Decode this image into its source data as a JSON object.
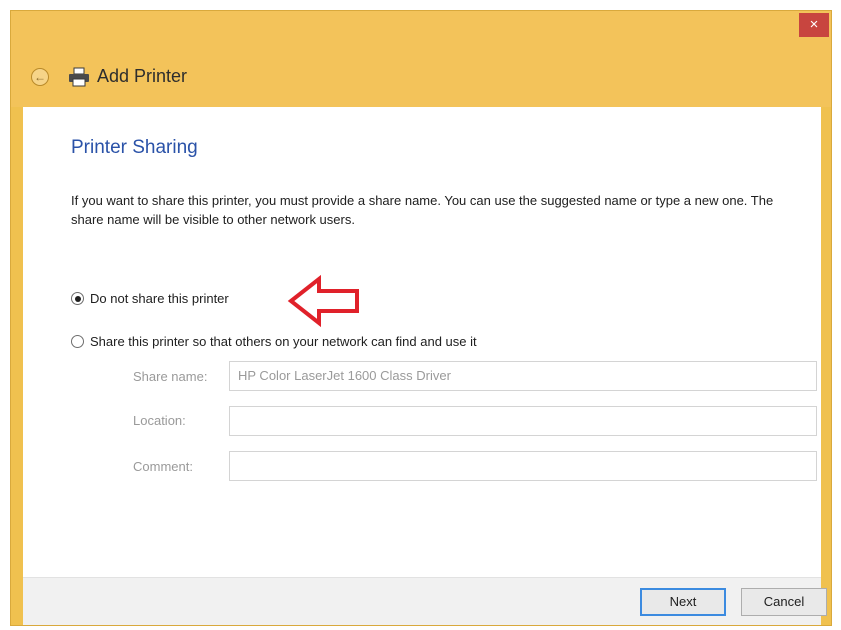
{
  "window": {
    "title": "Add Printer",
    "close_glyph": "×",
    "back_glyph": "←"
  },
  "page": {
    "heading": "Printer Sharing",
    "description": "If you want to share this printer, you must provide a share name. You can use the suggested name or type a new one. The share name will be visible to other network users."
  },
  "sharing_options": {
    "do_not_share_label": "Do not share this printer",
    "do_not_share_selected": true,
    "share_label": "Share this printer so that others on your network can find and use it",
    "share_selected": false
  },
  "fields": {
    "share_name_label": "Share name:",
    "share_name_value": "HP Color LaserJet 1600 Class Driver",
    "location_label": "Location:",
    "location_value": "",
    "comment_label": "Comment:",
    "comment_value": ""
  },
  "buttons": {
    "next_label": "Next",
    "cancel_label": "Cancel"
  },
  "icons": {
    "back": "back-arrow-icon",
    "printer": "printer-icon",
    "close": "close-icon",
    "annotation": "red-arrow-icon"
  },
  "colors": {
    "titlebar": "#f3c35a",
    "heading": "#2a52a8",
    "close": "#c8453f",
    "annotation_arrow": "#e0212a"
  }
}
